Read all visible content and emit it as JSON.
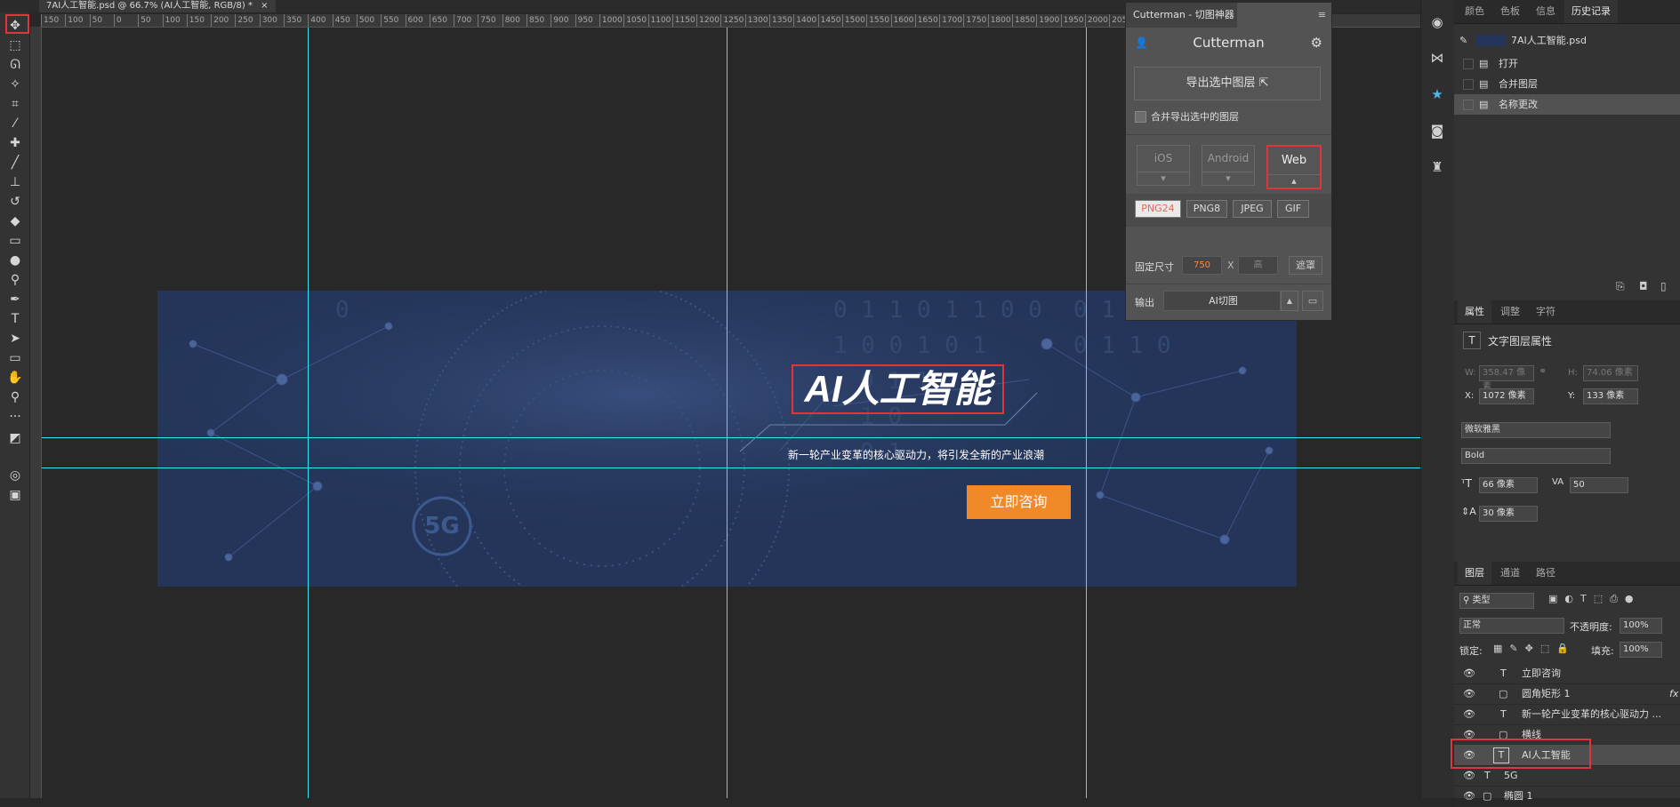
{
  "document": {
    "tab_title": "7AI人工智能.psd @ 66.7% (AI人工智能, RGB/8) *",
    "close_glyph": "×"
  },
  "ruler": {
    "labels": [
      "150",
      "100",
      "50",
      "0",
      "50",
      "100",
      "150",
      "200",
      "250",
      "300",
      "350",
      "400",
      "450",
      "500",
      "550",
      "600",
      "650",
      "700",
      "750",
      "800",
      "850",
      "900",
      "950",
      "1000",
      "1050",
      "1100",
      "1150",
      "1200",
      "1250",
      "1300",
      "1350",
      "1400",
      "1450",
      "1500",
      "1550",
      "1600",
      "1650",
      "1700",
      "1750",
      "1800",
      "1850",
      "1900",
      "1950",
      "2000",
      "2050"
    ]
  },
  "banner": {
    "title": "AI人工智能",
    "subtitle": "新一轮产业变革的核心驱动力，将引发全新的产业浪潮",
    "cta": "立即咨询",
    "badge": "5G",
    "bg_color": "#243559",
    "cta_color": "#f08a29"
  },
  "cutterman": {
    "tab_label": "Cutterman - 切图神器",
    "title": "Cutterman",
    "export_btn": "导出选中图层",
    "merge_label": "合并导出选中的图层",
    "platforms": [
      "iOS",
      "Android",
      "Web"
    ],
    "active_platform": "Web",
    "formats": [
      "PNG24",
      "PNG8",
      "JPEG",
      "GIF"
    ],
    "active_format": "PNG24",
    "fixed_size_label": "固定尺寸",
    "width_value": "750",
    "x_label": "X",
    "height_placeholder": "高",
    "mask_btn": "遮罩",
    "output_label": "输出",
    "output_value": "AI切图"
  },
  "history_panel": {
    "tabs": [
      "颜色",
      "色板",
      "信息",
      "历史记录"
    ],
    "active_tab": "历史记录",
    "snapshot": "7AI人工智能.psd",
    "items": [
      "打开",
      "合并图层",
      "名称更改"
    ]
  },
  "properties_panel": {
    "tabs": [
      "属性",
      "调整",
      "字符"
    ],
    "active_tab": "属性",
    "header": "文字图层属性",
    "w_label": "W:",
    "w_value": "358.47 像素",
    "h_label": "H:",
    "h_value": "74.06 像素",
    "x_label": "X:",
    "x_value": "1072 像素",
    "y_label": "Y:",
    "y_value": "133 像素",
    "font_family": "微软雅黑",
    "font_style": "Bold",
    "font_size": "66 像素",
    "tracking": "50",
    "leading": "30 像素"
  },
  "layers_panel": {
    "tabs": [
      "图层",
      "通道",
      "路径"
    ],
    "active_tab": "图层",
    "filter": "类型",
    "blend_mode": "正常",
    "opacity_label": "不透明度:",
    "opacity": "100%",
    "lock_label": "锁定:",
    "fill_label": "填充:",
    "fill": "100%",
    "layers": [
      {
        "name": "立即咨询",
        "type": "T"
      },
      {
        "name": "圆角矩形 1",
        "type": "shape",
        "fx": "fx"
      },
      {
        "name": "新一轮产业变革的核心驱动力 ...",
        "type": "T"
      },
      {
        "name": "横线",
        "type": "shape"
      },
      {
        "name": "AI人工智能",
        "type": "T",
        "selected": true
      },
      {
        "name": "5G",
        "type": "T"
      },
      {
        "name": "椭圆 1",
        "type": "shape"
      }
    ]
  },
  "colors": {
    "guide": "#36e5f0",
    "highlight": "#e0363a"
  }
}
